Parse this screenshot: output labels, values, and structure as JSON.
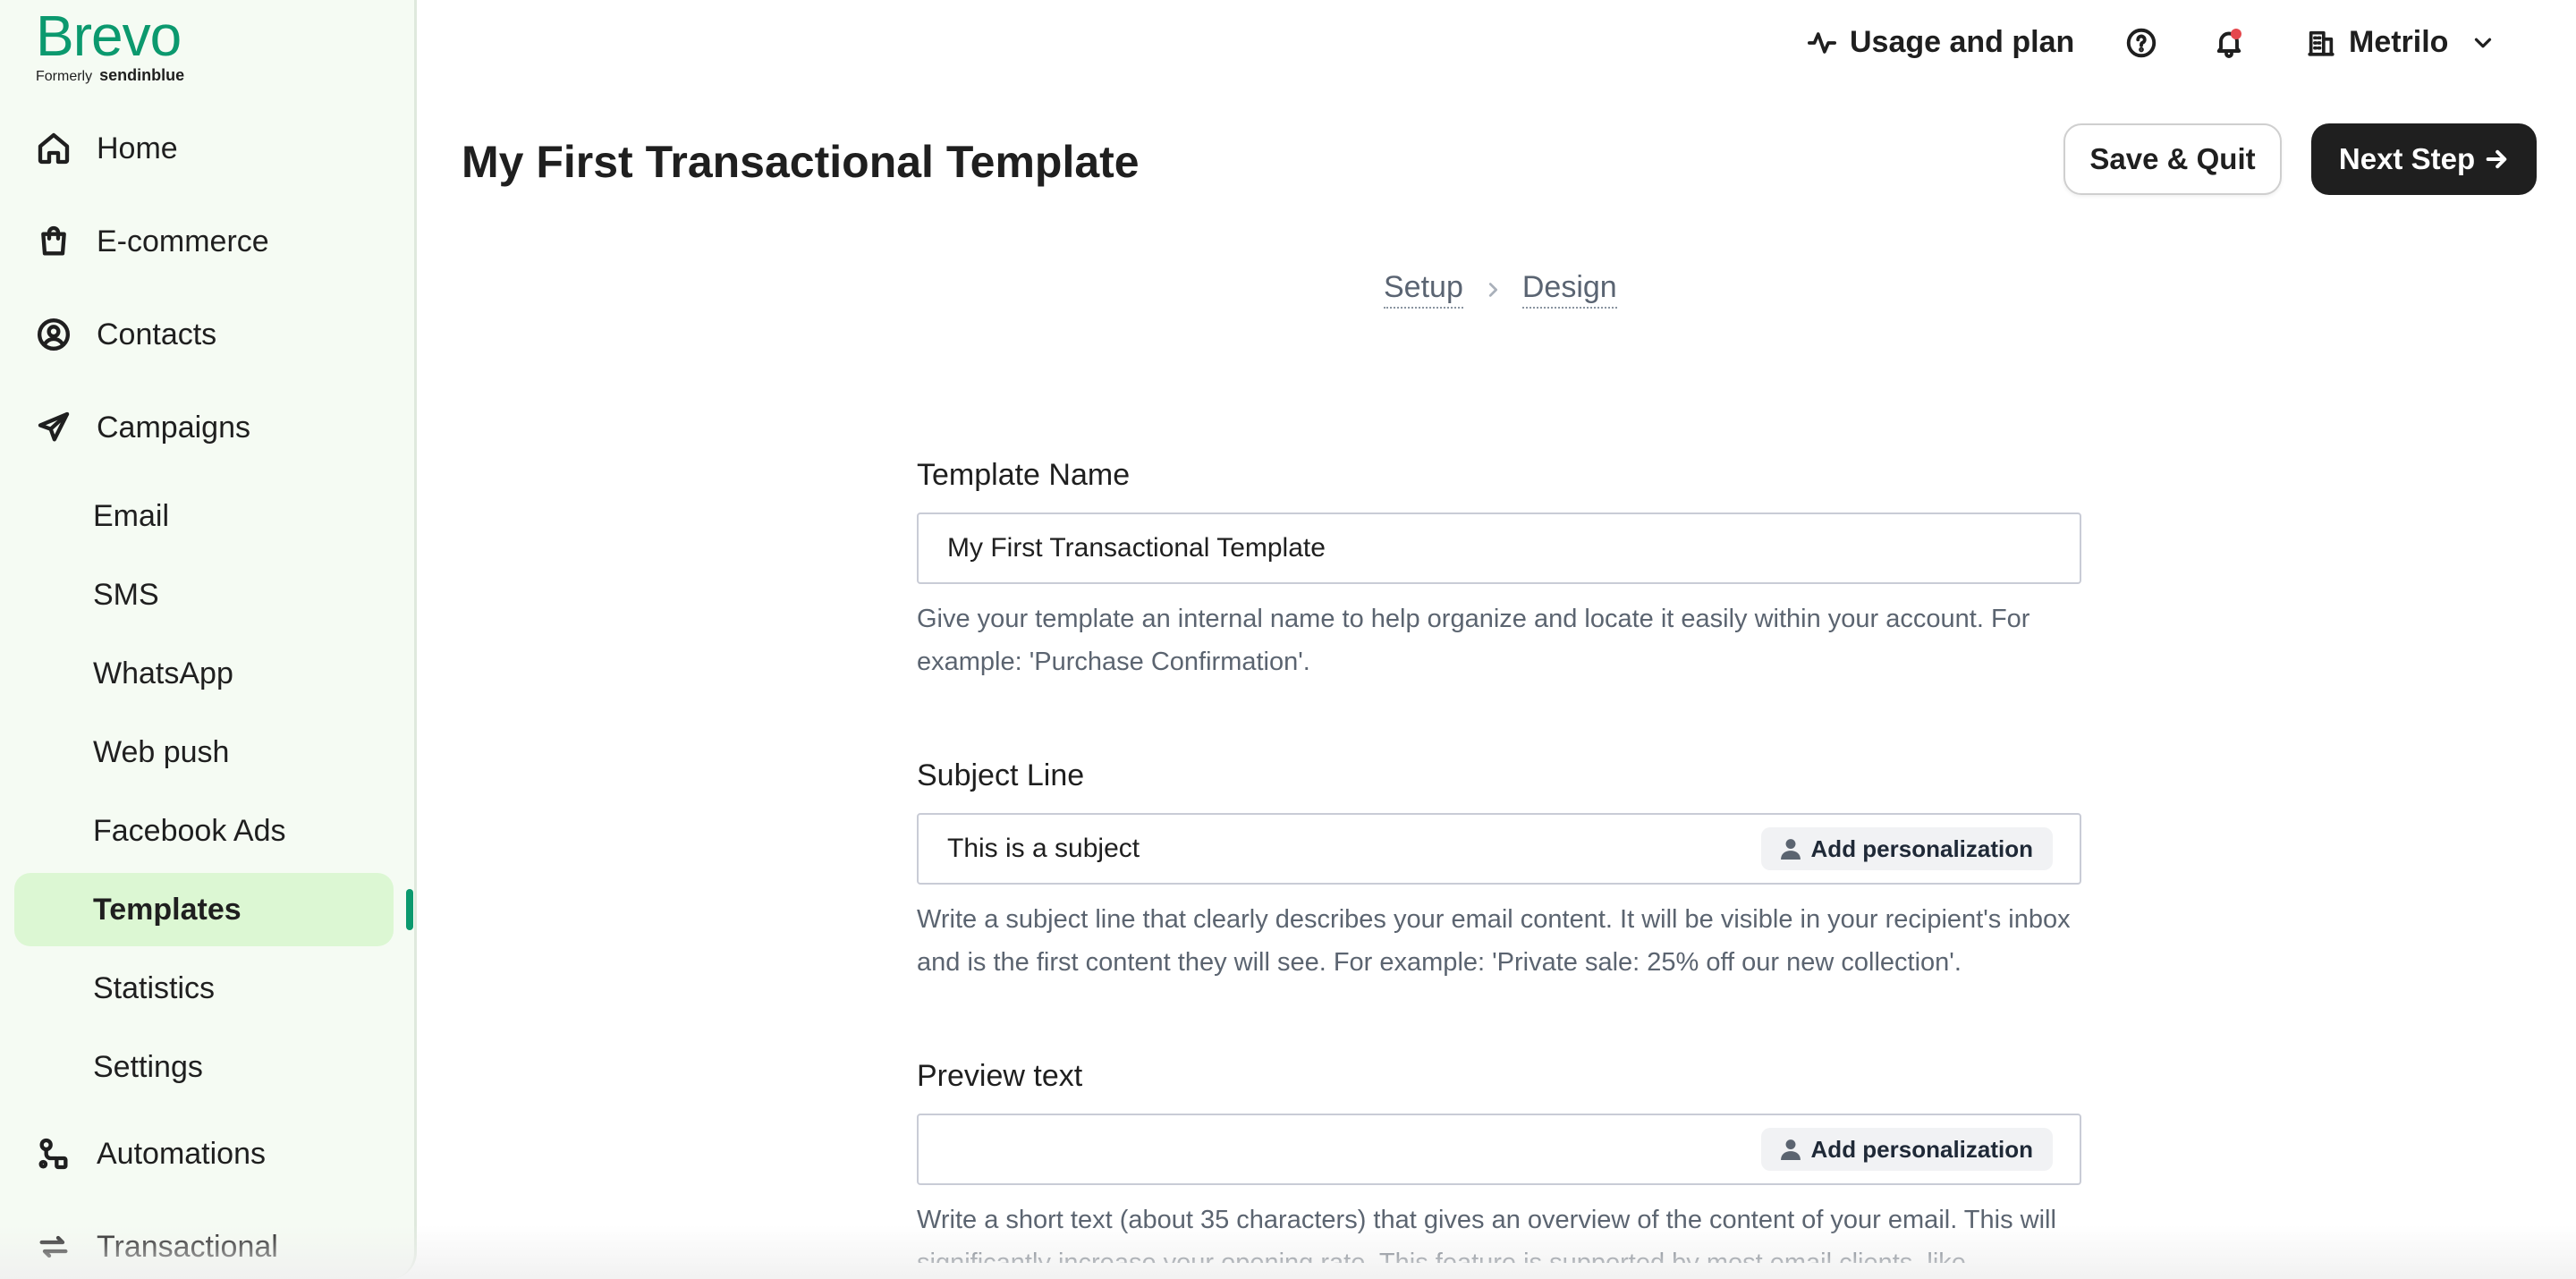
{
  "brand": {
    "name": "Brevo",
    "formerly": "Formerly",
    "former_name": "sendinblue",
    "color": "#0b996e"
  },
  "sidebar": {
    "items": [
      {
        "label": "Home",
        "icon": "home-icon"
      },
      {
        "label": "E-commerce",
        "icon": "shopping-bag-icon"
      },
      {
        "label": "Contacts",
        "icon": "user-circle-icon"
      },
      {
        "label": "Campaigns",
        "icon": "paper-plane-icon"
      }
    ],
    "campaign_sub": [
      "Email",
      "SMS",
      "WhatsApp",
      "Web push",
      "Facebook Ads",
      "Templates",
      "Statistics",
      "Settings"
    ],
    "active_sub": "Templates",
    "automations": {
      "label": "Automations",
      "icon": "automation-icon"
    },
    "transactional": {
      "label": "Transactional",
      "icon": "transactional-icon"
    }
  },
  "topbar": {
    "usage_label": "Usage and plan",
    "account_name": "Metrilo",
    "notification_dot_color": "#e5484d"
  },
  "header": {
    "title": "My First Transactional Template",
    "save_quit": "Save & Quit",
    "next_step": "Next Step"
  },
  "stepper": {
    "steps": [
      "Setup",
      "Design"
    ]
  },
  "form": {
    "template_name": {
      "label": "Template Name",
      "value": "My First Transactional Template",
      "help": "Give your template an internal name to help organize and locate it easily within your account. For example: 'Purchase Confirmation'."
    },
    "subject_line": {
      "label": "Subject Line",
      "value": "This is a subject",
      "personalization": "Add personalization",
      "help": "Write a subject line that clearly describes your email content. It will be visible in your recipient's inbox and is the first content they will see. For example: 'Private sale: 25% off our new collection'."
    },
    "preview_text": {
      "label": "Preview text",
      "value": "",
      "personalization": "Add personalization",
      "help": "Write a short text (about 35 characters) that gives an overview of the content of your email. This will significantly increase your opening rate. This feature is supported by most email clients, like"
    }
  }
}
